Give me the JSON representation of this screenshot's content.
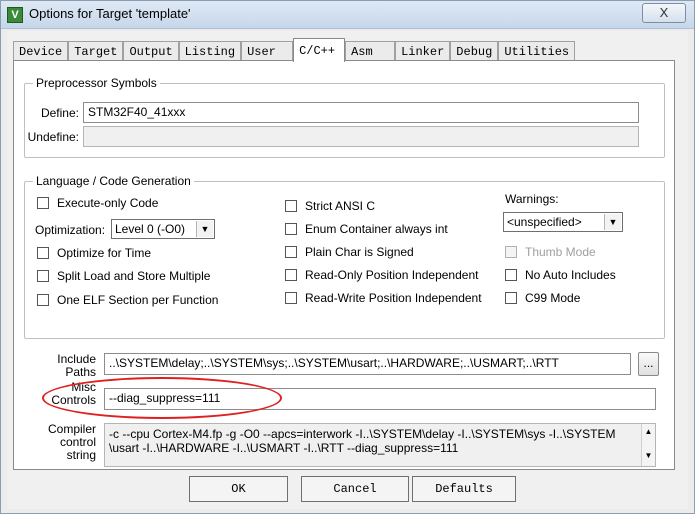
{
  "window": {
    "title": "Options for Target 'template'",
    "close_label": "X",
    "app_icon_glyph": "V"
  },
  "tabs": [
    {
      "label": "Device"
    },
    {
      "label": "Target"
    },
    {
      "label": "Output"
    },
    {
      "label": "Listing"
    },
    {
      "label": "User"
    },
    {
      "label": "C/C++"
    },
    {
      "label": "Asm"
    },
    {
      "label": "Linker"
    },
    {
      "label": "Debug"
    },
    {
      "label": "Utilities"
    }
  ],
  "preprocessor": {
    "legend": "Preprocessor Symbols",
    "define_label": "Define:",
    "define_value": "STM32F40_41xxx",
    "undefine_label": "Undefine:",
    "undefine_value": ""
  },
  "codegen": {
    "legend": "Language / Code Generation",
    "execute_only": "Execute-only Code",
    "optimization_label": "Optimization:",
    "optimization_value": "Level 0 (-O0)",
    "optimize_time": "Optimize for Time",
    "split_load": "Split Load and Store Multiple",
    "one_elf": "One ELF Section per Function",
    "strict_ansi": "Strict ANSI C",
    "enum_container": "Enum Container always int",
    "plain_char": "Plain Char is Signed",
    "ropi": "Read-Only Position Independent",
    "rwpi": "Read-Write Position Independent",
    "warnings_label": "Warnings:",
    "warnings_value": "<unspecified>",
    "thumb_mode": "Thumb Mode",
    "no_auto_includes": "No Auto Includes",
    "c99_mode": "C99 Mode"
  },
  "paths": {
    "include_label_1": "Include",
    "include_label_2": "Paths",
    "include_value": "..\\SYSTEM\\delay;..\\SYSTEM\\sys;..\\SYSTEM\\usart;..\\HARDWARE;..\\USMART;..\\RTT",
    "browse_label": "...",
    "misc_label_1": "Misc",
    "misc_label_2": "Controls",
    "misc_value": "--diag_suppress=111",
    "compiler_label_1": "Compiler",
    "compiler_label_2": "control",
    "compiler_label_3": "string",
    "compiler_line_1": "-c --cpu Cortex-M4.fp -g -O0 --apcs=interwork -I..\\SYSTEM\\delay -I..\\SYSTEM\\sys -I..\\SYSTEM",
    "compiler_line_2": "\\usart -I..\\HARDWARE -I..\\USMART -I..\\RTT  --diag_suppress=111"
  },
  "buttons": {
    "ok": "OK",
    "cancel": "Cancel",
    "defaults": "Defaults"
  },
  "colors": {
    "annotation": "#e02020",
    "app_icon": "#3a8a3a"
  }
}
